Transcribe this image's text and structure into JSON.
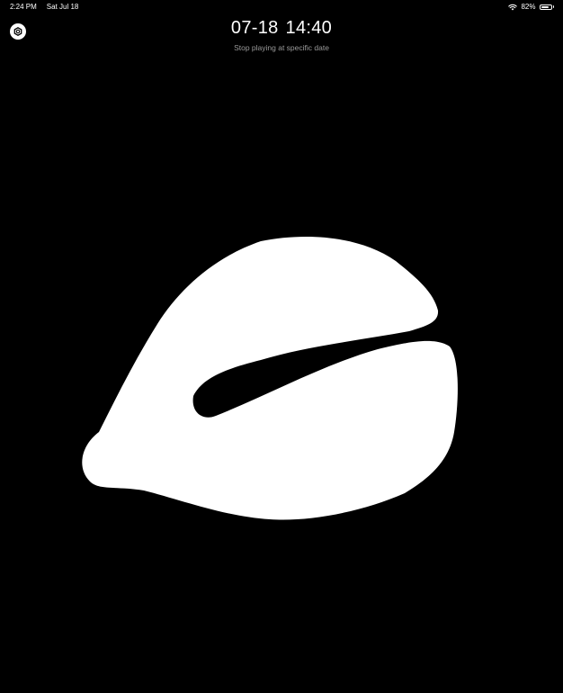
{
  "status_bar": {
    "time": "2:24 PM",
    "date": "Sat Jul 18",
    "battery_text": "82%",
    "battery_level": 0.82
  },
  "header": {
    "date_value": "07-18",
    "time_value": "14:40",
    "subtitle": "Stop playing at specific date"
  },
  "icons": {
    "settings": "hexagon-settings-icon",
    "wifi": "wifi-icon",
    "battery": "battery-icon"
  },
  "colors": {
    "background": "#000000",
    "foreground": "#ffffff",
    "subtitle": "#9a9a9a"
  }
}
